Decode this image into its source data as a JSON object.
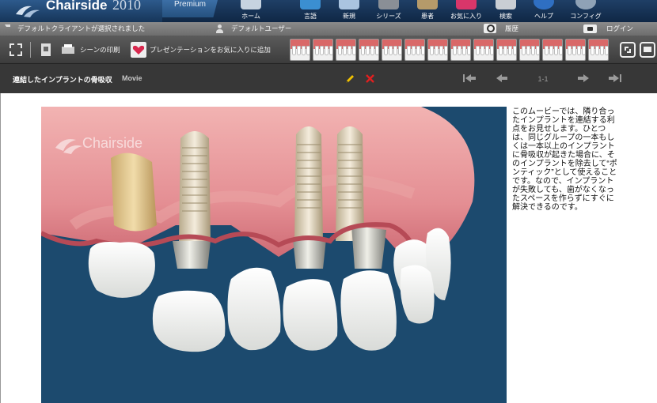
{
  "app": {
    "brand": "Chairside",
    "year": "2010",
    "edition": "Premium"
  },
  "nav": [
    {
      "label": "ホーム",
      "icon": "home-icon"
    },
    {
      "label": "言語",
      "icon": "language-icon"
    },
    {
      "label": "新規",
      "icon": "new-icon"
    },
    {
      "label": "シリーズ",
      "icon": "series-icon"
    },
    {
      "label": "患者",
      "icon": "patient-icon"
    },
    {
      "label": "お気に入り",
      "icon": "favorites-icon"
    },
    {
      "label": "検索",
      "icon": "search-icon"
    },
    {
      "label": "ヘルプ",
      "icon": "help-icon"
    },
    {
      "label": "コンフィグ",
      "icon": "config-icon"
    }
  ],
  "status": {
    "client": "デフォルトクライアントが選択されました",
    "user": "デフォルトユーザー",
    "history": "履歴",
    "login": "ログイン"
  },
  "toolbar": {
    "print_scene": "シーンの印刷",
    "add_favorite": "プレゼンテーションをお気に入りに追加",
    "thumbnail_count": 14
  },
  "movie": {
    "title": "連結したインプラントの骨吸収",
    "type": "Movie",
    "page": "1-1",
    "watermark": "Chairside",
    "description": "このムービーでは、隣り合ったインプラントを連結する利点をお見せします。ひとつは、同じグループの一本もしくは一本以上のインプラントに骨吸収が起きた場合に、そのインプラントを除去して“ポンティック”として使えることです。なので、インプラントが失敗しても、歯がなくなったスペースを作らずにすぐに解決できるのです。"
  },
  "colors": {
    "topbar": "#1f3f66",
    "scene_background": "#1c4a6e",
    "gum": "#e58f95",
    "edit": "#f2c200",
    "delete": "#e02020"
  }
}
